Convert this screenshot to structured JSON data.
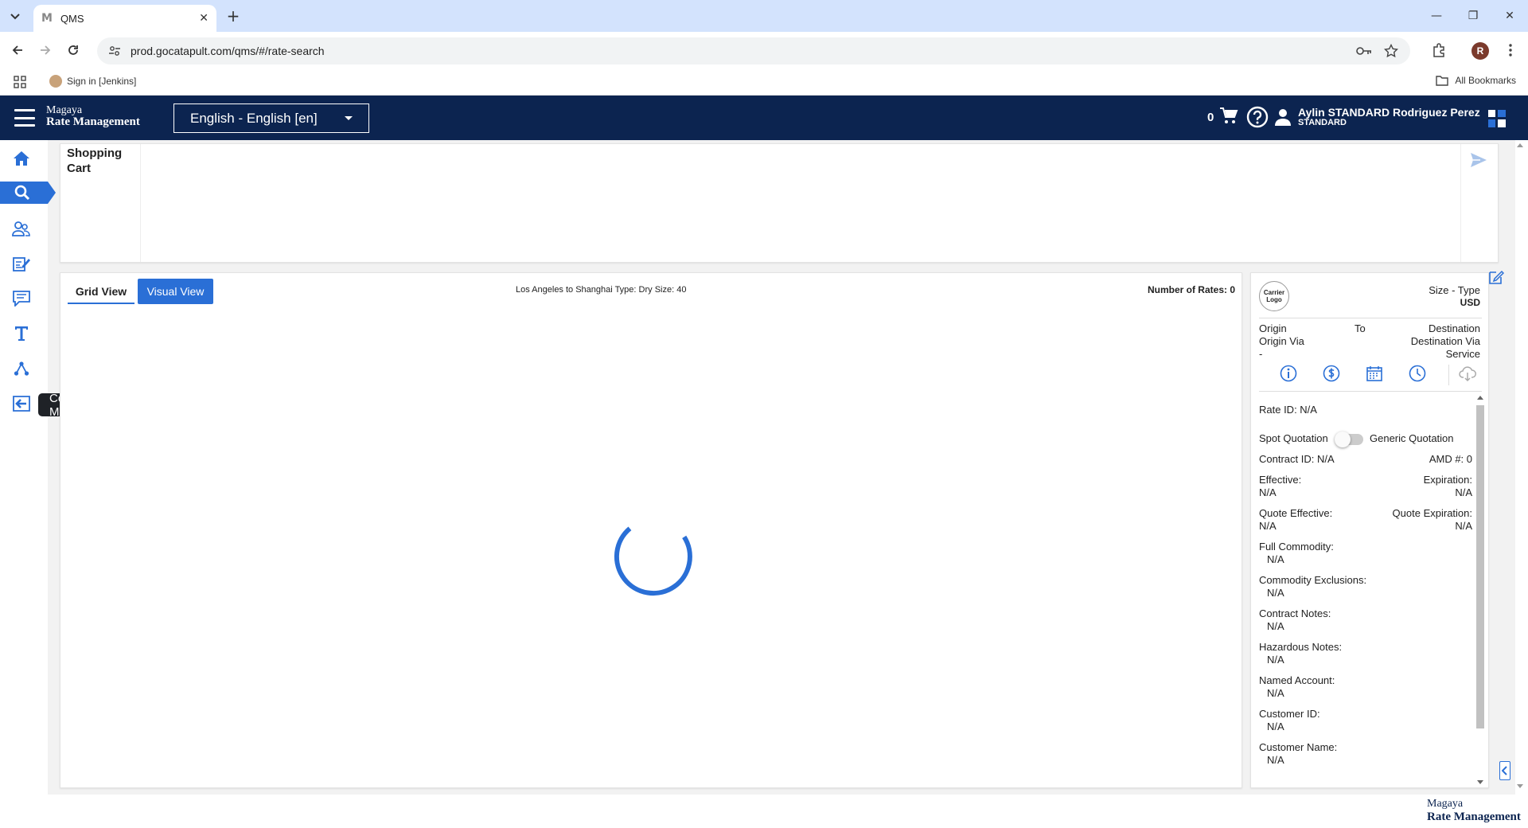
{
  "browser": {
    "tab_title": "QMS",
    "tab_favicon": "M",
    "url": "prod.gocatapult.com/qms/#/rate-search",
    "profile_initial": "R",
    "bookmarks": [
      {
        "label": "Sign in [Jenkins]",
        "icon": "jenkins-icon"
      }
    ],
    "all_bookmarks_label": "All Bookmarks"
  },
  "header": {
    "brand_line1": "Magaya",
    "brand_line2": "Rate Management",
    "language": "English - English [en]",
    "cart_count": "0",
    "user_name": "Aylin STANDARD Rodriguez Perez",
    "user_role": "STANDARD",
    "colors": {
      "header_bg": "#0c2450",
      "accent": "#2a6fd6"
    }
  },
  "sidebar": {
    "items": [
      {
        "name": "home",
        "icon": "home-icon"
      },
      {
        "name": "rate-search",
        "icon": "search-icon",
        "active": true
      },
      {
        "name": "customers",
        "icon": "users-icon"
      },
      {
        "name": "contract-management",
        "icon": "contract-icon"
      },
      {
        "name": "messages",
        "icon": "chat-icon"
      },
      {
        "name": "text",
        "icon": "text-t-icon"
      },
      {
        "name": "network",
        "icon": "network-icon"
      },
      {
        "name": "logout",
        "icon": "logout-icon"
      }
    ],
    "tooltip": "Contract Management"
  },
  "cart": {
    "label": "Shopping Cart"
  },
  "grid": {
    "tab_grid": "Grid View",
    "tab_visual": "Visual View",
    "route_info": "Los Angeles to Shanghai Type: Dry Size: 40",
    "num_rates": "Number of Rates: 0"
  },
  "detail": {
    "carrier_logo_line1": "Carrier",
    "carrier_logo_line2": "Logo",
    "size_type": "Size - Type",
    "currency": "USD",
    "origin": "Origin",
    "to": "To",
    "destination": "Destination",
    "origin_via": "Origin Via",
    "destination_via": "Destination Via",
    "dash": "-",
    "service": "Service",
    "rate_id": "Rate ID: N/A",
    "spot_quotation": "Spot Quotation",
    "generic_quotation": "Generic Quotation",
    "contract_id": "Contract ID: N/A",
    "amd": "AMD #: 0",
    "effective_label": "Effective:",
    "effective_value": "N/A",
    "expiration_label": "Expiration:",
    "expiration_value": "N/A",
    "quote_effective_label": "Quote Effective:",
    "quote_effective_value": "N/A",
    "quote_expiration_label": "Quote Expiration:",
    "quote_expiration_value": "N/A",
    "full_commodity_label": "Full Commodity:",
    "full_commodity_value": "N/A",
    "commodity_exclusions_label": "Commodity Exclusions:",
    "commodity_exclusions_value": "N/A",
    "contract_notes_label": "Contract Notes:",
    "contract_notes_value": "N/A",
    "hazardous_notes_label": "Hazardous Notes:",
    "hazardous_notes_value": "N/A",
    "named_account_label": "Named Account:",
    "named_account_value": "N/A",
    "customer_id_label": "Customer ID:",
    "customer_id_value": "N/A",
    "customer_name_label": "Customer Name:",
    "customer_name_value": "N/A"
  },
  "footer": {
    "brand_line1": "Magaya",
    "brand_line2": "Rate Management"
  }
}
